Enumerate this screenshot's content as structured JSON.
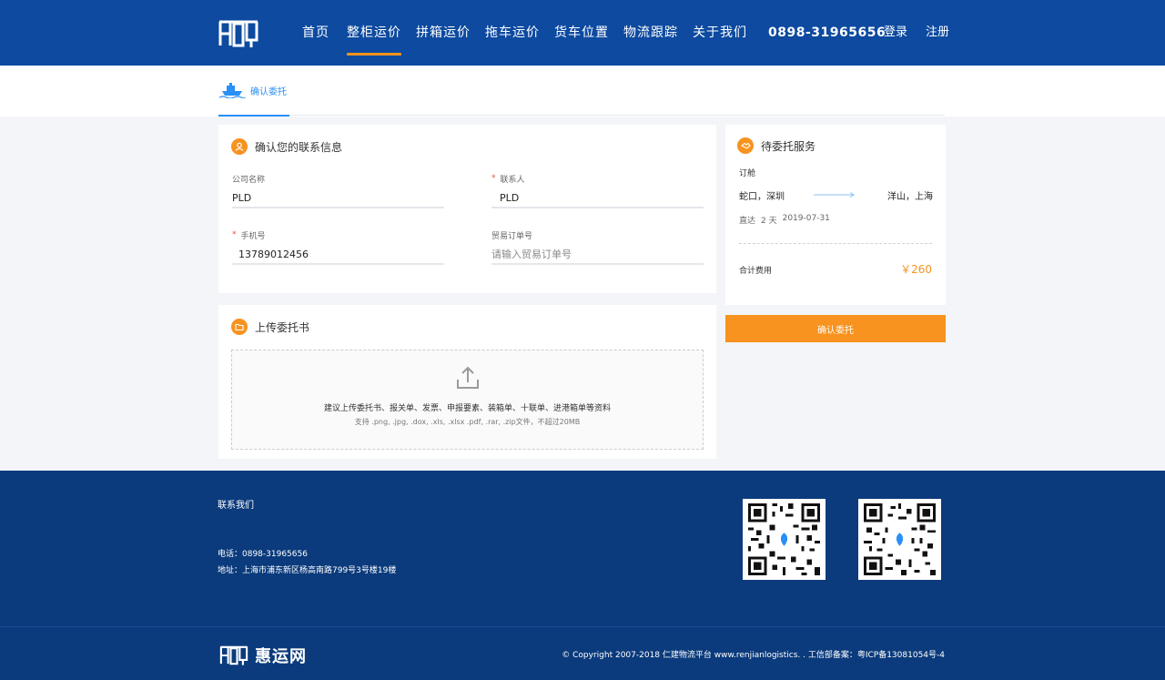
{
  "nav": {
    "items": [
      {
        "label": "首页",
        "active": false
      },
      {
        "label": "整柜运价",
        "active": true
      },
      {
        "label": "拼箱运价",
        "active": false
      },
      {
        "label": "拖车运价",
        "active": false
      },
      {
        "label": "货车位置",
        "active": false
      },
      {
        "label": "物流跟踪",
        "active": false
      },
      {
        "label": "关于我们",
        "active": false
      }
    ],
    "phone": "0898-31965656",
    "login": "登录",
    "register": "注册"
  },
  "subtab": {
    "label": "确认委托"
  },
  "contact": {
    "title": "确认您的联系信息",
    "company_label": "公司名称",
    "company_value": "PLD",
    "contact_label": "联系人",
    "contact_value": "PLD",
    "phone_label": "手机号",
    "phone_value": "13789012456",
    "order_label": "贸易订单号",
    "order_placeholder": "请输入贸易订单号"
  },
  "upload": {
    "title": "上传委托书",
    "hint": "建议上传委托书、报关单、发票、申报要素、装箱单、十联单、进港箱单等资料",
    "formats": "支持 .png, .jpg, .dox, .xls, .xlsx .pdf, .rar, .zip文件，不超过20MB"
  },
  "service": {
    "title": "待委托服务",
    "type": "订舱",
    "from": "蛇口，深圳",
    "to": "洋山，上海",
    "direct": "直达",
    "days": "2 天",
    "date": "2019-07-31",
    "total_label": "合计费用",
    "total_value": "￥260"
  },
  "confirm_button": "确认委托",
  "footer": {
    "title": "联系我们",
    "tel": "电话：0898-31965656",
    "address": "地址：上海市浦东新区杨高南路799号3号楼19楼",
    "brand": "惠运网",
    "copyright": "© Copyright 2007-2018  仁建物流平台 www.renjianlogistics. . 工信部备案：粤ICP备13081054号-4"
  },
  "colors": {
    "primary": "#0d4aa0",
    "accent": "#f7931e",
    "link": "#2a8ff7",
    "footer": "#0b3b7c"
  }
}
